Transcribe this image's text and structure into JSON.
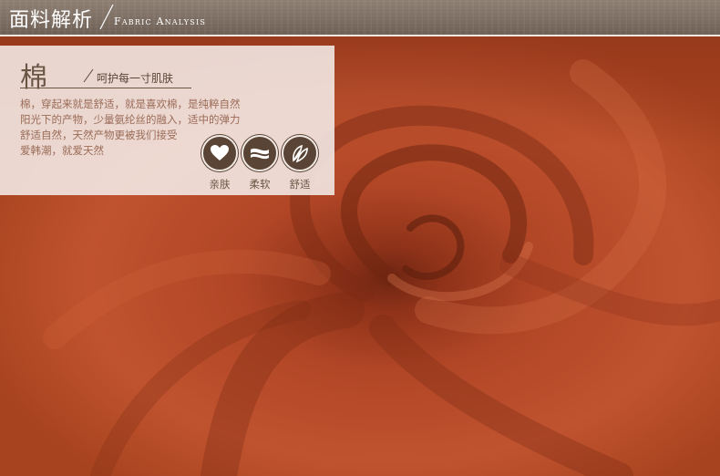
{
  "header": {
    "title_cn": "面料解析",
    "title_en": "Fabric Analysis"
  },
  "fabric": {
    "name": "棉",
    "slogan": "呵护每一寸肌肤",
    "description_lines": [
      "棉，穿起来就是舒适，就是喜欢棉，是纯粹自然",
      "阳光下的产物，少量氨纶丝的融入，适中的弹力",
      "舒适自然，天然产物更被我们接受",
      "爱韩潮，就爱天然"
    ]
  },
  "features": [
    {
      "icon": "heart-icon",
      "label": "亲肤"
    },
    {
      "icon": "fabric-layers-icon",
      "label": "柔软"
    },
    {
      "icon": "leaf-icon",
      "label": "舒适"
    }
  ],
  "colors": {
    "fabric": "#b5492a",
    "badge": "#5a4435",
    "header": "#7d6e63",
    "panel": "#f4ece8"
  }
}
